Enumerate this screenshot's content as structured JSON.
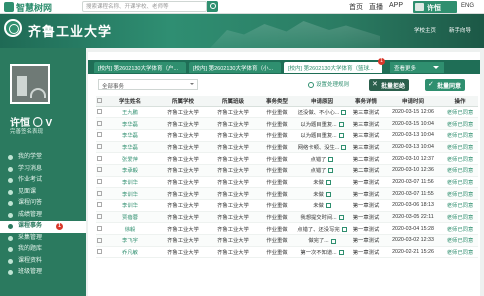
{
  "topbar": {
    "logo": "智慧树网",
    "search_placeholder": "搜索课程名称、开课学校、老师等",
    "nav": [
      "首页",
      "直播",
      "APP"
    ],
    "user": "许恒",
    "lang": "ENG"
  },
  "banner": {
    "school": "齐鲁工业大学",
    "links": [
      "学校主页",
      "新手向导"
    ]
  },
  "sidebar": {
    "name": "许恒 〇 V",
    "subtitle": "完善签名表现",
    "items": [
      {
        "label": "我的学堂"
      },
      {
        "label": "学习消息"
      },
      {
        "label": "作业考试"
      },
      {
        "label": "见面课"
      },
      {
        "label": "课程问答"
      },
      {
        "label": "成绩管理"
      },
      {
        "label": "课程事务",
        "badge": "1"
      },
      {
        "label": "采集管理"
      },
      {
        "label": "我的题库"
      },
      {
        "label": "课程资料"
      },
      {
        "label": "班级管理"
      }
    ],
    "active_index": 6
  },
  "tabs": {
    "items": [
      {
        "label": "[校内] 第2602130大学体育（户..."
      },
      {
        "label": "[校内] 第2602130大学体育（小..."
      },
      {
        "label": "[校内] 第2602130大学体育（篮球...",
        "badge": "1"
      }
    ],
    "selected_index": 2,
    "more": "查看更多"
  },
  "toolbar": {
    "filter": "全部事务",
    "setting": "设置处理规则",
    "reject": "批量拒绝",
    "accept": "批量同意"
  },
  "table": {
    "headers": [
      "学生姓名",
      "所属学校",
      "所属班级",
      "事务类型",
      "申请原因",
      "事务详情",
      "申请时间",
      "操作"
    ],
    "rows": [
      [
        "王九鹏",
        "齐鲁工业大学",
        "齐鲁工业大学",
        "作业重做",
        "还没做、不小心...",
        "第三章测试",
        "2020-03-15 12:06",
        "老师已同意"
      ],
      [
        "李华磊",
        "齐鲁工业大学",
        "齐鲁工业大学",
        "作业重做",
        "以为题目重复...",
        "第三章测试",
        "2020-03-15 10:04",
        "老师已同意"
      ],
      [
        "李华磊",
        "齐鲁工业大学",
        "齐鲁工业大学",
        "作业重做",
        "以为题目重复...",
        "第三章测试",
        "2020-03-13 10:04",
        "老师已同意"
      ],
      [
        "李华磊",
        "齐鲁工业大学",
        "齐鲁工业大学",
        "作业重做",
        "网络卡顿、没生...",
        "第三章测试",
        "2020-03-13 10:04",
        "老师已同意"
      ],
      [
        "张爱萍",
        "齐鲁工业大学",
        "齐鲁工业大学",
        "作业重做",
        "点错了",
        "第二章测试",
        "2020-03-10 12:37",
        "老师已同意"
      ],
      [
        "李承毅",
        "齐鲁工业大学",
        "齐鲁工业大学",
        "作业重做",
        "点错了",
        "第二章测试",
        "2020-03-10 12:36",
        "老师已同意"
      ],
      [
        "李训华",
        "齐鲁工业大学",
        "齐鲁工业大学",
        "作业重做",
        "未做",
        "第一章测试",
        "2020-03-07 11:56",
        "老师已同意"
      ],
      [
        "李训华",
        "齐鲁工业大学",
        "齐鲁工业大学",
        "作业重做",
        "未做",
        "第一章测试",
        "2020-03-07 11:55",
        "老师已同意"
      ],
      [
        "李训华",
        "齐鲁工业大学",
        "齐鲁工业大学",
        "作业重做",
        "未做",
        "第一章测试",
        "2020-03-06 18:13",
        "老师已同意"
      ],
      [
        "贾蓓蓉",
        "齐鲁工业大学",
        "齐鲁工业大学",
        "作业重做",
        "我想提交时间...",
        "第一章测试",
        "2020-03-05 22:11",
        "老师已同意"
      ],
      [
        "徐毅",
        "齐鲁工业大学",
        "齐鲁工业大学",
        "作业重做",
        "点错了、还没写完",
        "第一章测试",
        "2020-03-04 15:28",
        "老师已同意"
      ],
      [
        "李飞宇",
        "齐鲁工业大学",
        "齐鲁工业大学",
        "作业重做",
        "做完了...",
        "第一章测试",
        "2020-03-02 12:33",
        "老师已同意"
      ],
      [
        "乔凡敏",
        "齐鲁工业大学",
        "齐鲁工业大学",
        "作业重做",
        "第一次不知道...",
        "第一章测试",
        "2020-02-21 15:26",
        "老师已同意"
      ]
    ]
  },
  "colors": {
    "brand": "#2f8f6f",
    "sidebar": "#2b7a5f",
    "badge": "#d9372a"
  }
}
